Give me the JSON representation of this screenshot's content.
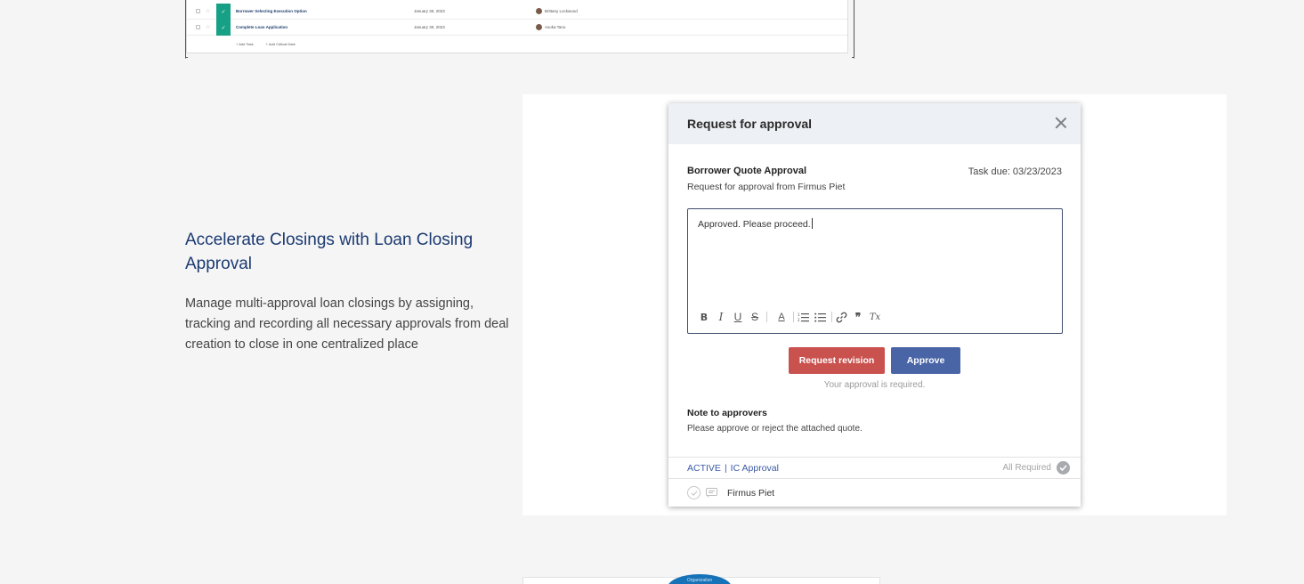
{
  "tasklist": {
    "rows": [
      {
        "name": "Borrower Selecting Execution Option",
        "date": "January 30, 2023",
        "user": "Brittany Lockwood"
      },
      {
        "name": "Complete Loan Application",
        "date": "January 30, 2023",
        "user": "Asoka Tano"
      }
    ],
    "add_task": "Add Task",
    "add_critical_date": "Add Critical Date"
  },
  "feature": {
    "title": "Accelerate Closings with Loan Closing Approval",
    "description": "Manage multi-approval loan closings by assigning, tracking and recording all necessary approvals from deal creation to close in one centralized place"
  },
  "modal": {
    "title": "Request for approval",
    "quote_title": "Borrower Quote Approval",
    "task_due": "Task due: 03/23/2023",
    "quote_subtitle": "Request for approval from Firmus Piet",
    "editor_text": "Approved. Please proceed.",
    "toolbar": {
      "bold": "B",
      "italic": "I",
      "underline": "U",
      "strike": "S",
      "color": "A",
      "quote": "❞",
      "clear": "Tx"
    },
    "request_revision": "Request revision",
    "approve": "Approve",
    "approval_required": "Your approval is required.",
    "note_title": "Note to approvers",
    "note_text": "Please approve or reject the attached quote.",
    "status": "ACTIVE",
    "status_separator": "|",
    "group": "IC Approval",
    "all_required": "All Required",
    "approver": "Firmus Piet"
  },
  "teaser": {
    "badge_text": "Organization"
  },
  "colors": {
    "accent_blue": "#1b3a70",
    "approve": "#4a65a6",
    "revise": "#c9524f",
    "task_green": "#16a085"
  }
}
